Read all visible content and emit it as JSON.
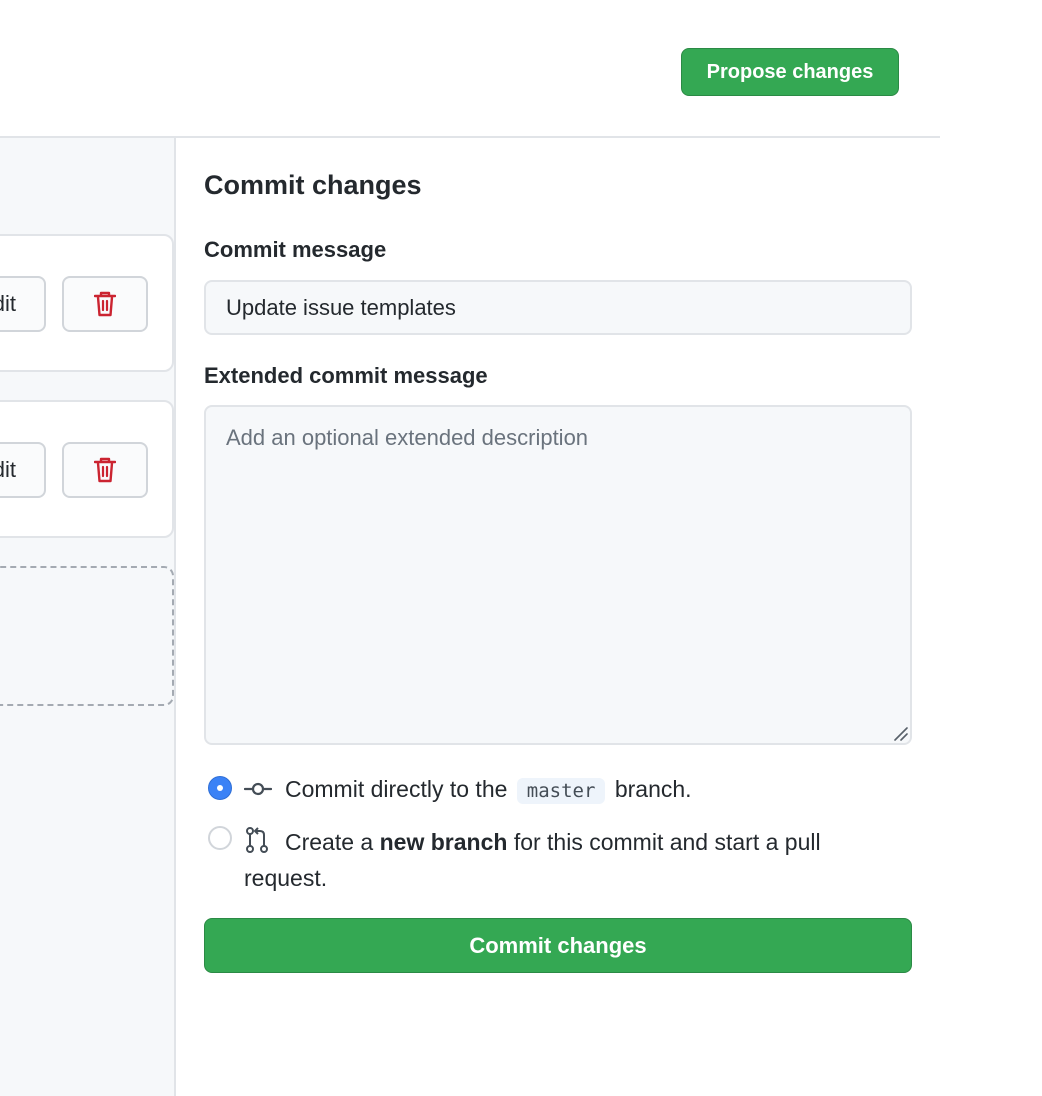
{
  "header": {
    "propose_label": "Propose changes"
  },
  "left": {
    "card1": {
      "edit_label": "Edit"
    },
    "card2": {
      "edit_label": "Edit"
    }
  },
  "commit": {
    "title": "Commit changes",
    "message_label": "Commit message",
    "message_value": "Update issue templates",
    "extended_label": "Extended commit message",
    "extended_placeholder": "Add an optional extended description",
    "option_direct": {
      "prefix": "Commit directly to the",
      "branch": "master",
      "suffix": "branch.",
      "checked": true
    },
    "option_branch": {
      "prefix": "Create a",
      "bold": "new branch",
      "suffix": "for this commit and start a pull",
      "line2": "request.",
      "checked": false
    },
    "submit_label": "Commit changes"
  },
  "colors": {
    "primary_green": "#34a853",
    "radio_blue": "#3b82f6",
    "danger_red": "#cb2431"
  },
  "icons": {
    "delete": "trash-icon",
    "commit": "git-commit-icon",
    "pull_request": "git-pull-request-icon",
    "resize": "resize-grip-icon"
  }
}
